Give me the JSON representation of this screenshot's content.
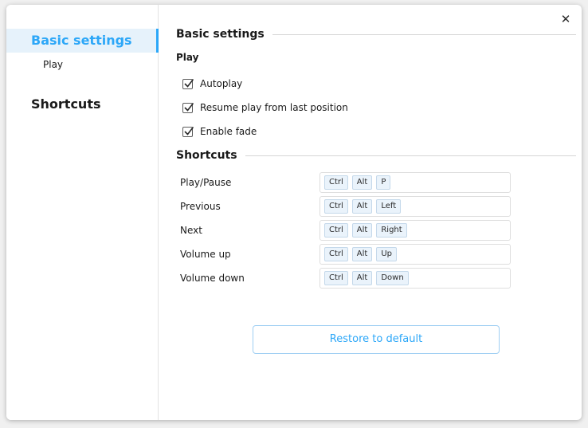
{
  "window": {
    "close_glyph": "✕"
  },
  "sidebar": {
    "items": [
      {
        "label": "Basic settings",
        "active": true
      },
      {
        "label": "Play",
        "active": false
      },
      {
        "label": "Shortcuts",
        "active": false
      }
    ]
  },
  "sections": {
    "basic": {
      "title": "Basic settings"
    },
    "shortcuts": {
      "title": "Shortcuts"
    }
  },
  "play": {
    "title": "Play",
    "options": [
      {
        "label": "Autoplay",
        "checked": true
      },
      {
        "label": "Resume play from last position",
        "checked": true
      },
      {
        "label": "Enable fade",
        "checked": true
      }
    ]
  },
  "shortcuts": [
    {
      "label": "Play/Pause",
      "keys": [
        "Ctrl",
        "Alt",
        "P"
      ]
    },
    {
      "label": "Previous",
      "keys": [
        "Ctrl",
        "Alt",
        "Left"
      ]
    },
    {
      "label": "Next",
      "keys": [
        "Ctrl",
        "Alt",
        "Right"
      ]
    },
    {
      "label": "Volume up",
      "keys": [
        "Ctrl",
        "Alt",
        "Up"
      ]
    },
    {
      "label": "Volume down",
      "keys": [
        "Ctrl",
        "Alt",
        "Down"
      ]
    }
  ],
  "restore_button": {
    "label": "Restore to default"
  },
  "colors": {
    "accent": "#2ca7f8",
    "active_bg": "#e6f2fb"
  }
}
